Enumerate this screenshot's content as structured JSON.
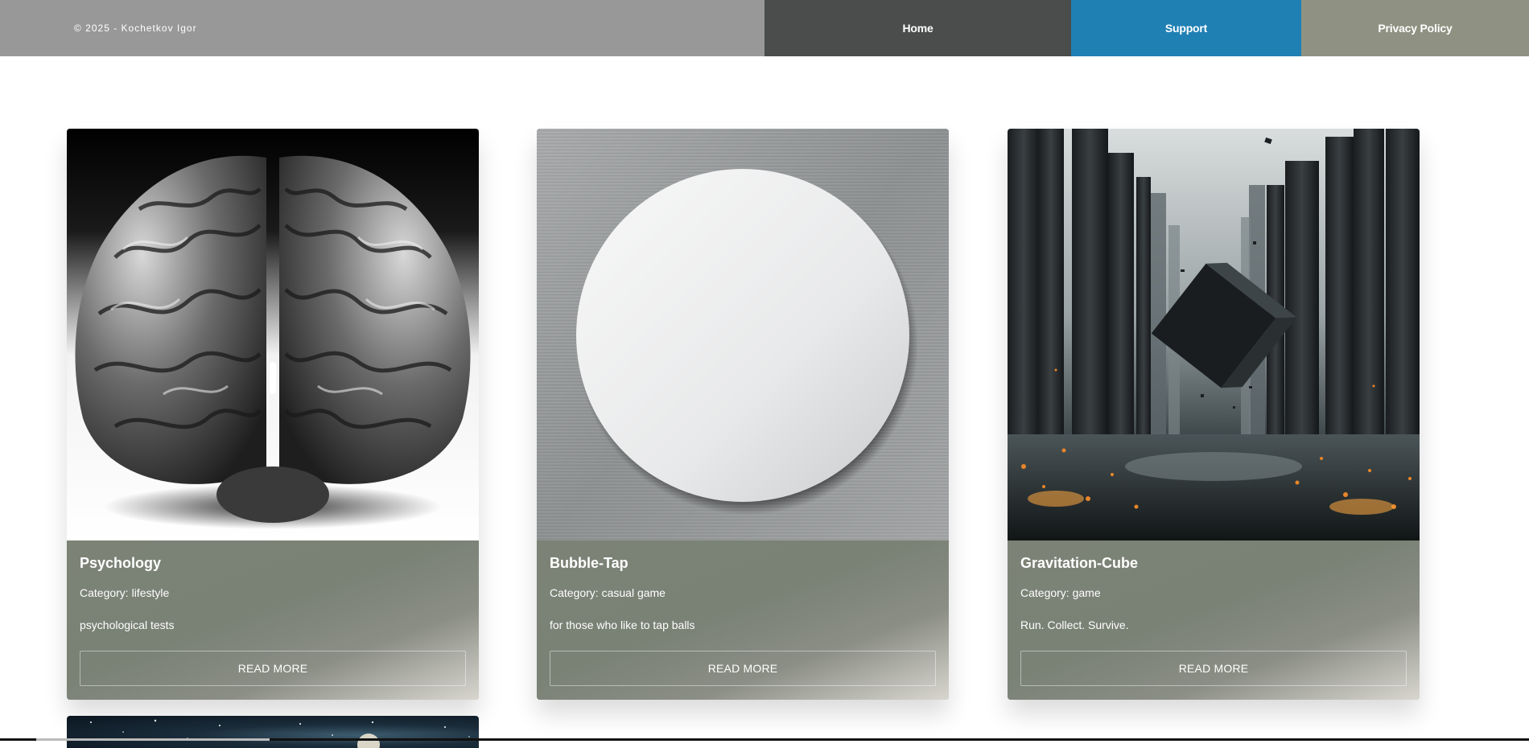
{
  "header": {
    "copyright": "© 2025 - Kochetkov Igor",
    "nav": [
      {
        "label": "Home",
        "color": "#4a4d4c"
      },
      {
        "label": "Support",
        "color": "#1f80b4"
      },
      {
        "label": "Privacy Policy",
        "color": "#8f9282"
      }
    ]
  },
  "cards": [
    {
      "title": "Psychology",
      "category": "Category: lifestyle",
      "description": "psychological tests",
      "button": "READ MORE",
      "image": "brain-image"
    },
    {
      "title": "Bubble-Tap",
      "category": "Category: casual game",
      "description": "for those who like to tap balls",
      "button": "READ MORE",
      "image": "white-disc-image"
    },
    {
      "title": "Gravitation-Cube",
      "category": "Category: game",
      "description": "Run. Collect. Survive.",
      "button": "READ MORE",
      "image": "floating-cube-city-image"
    }
  ],
  "partial_card": {
    "image": "space-image"
  },
  "colors": {
    "card_body": "#7a8173",
    "header_left": "#989898"
  }
}
